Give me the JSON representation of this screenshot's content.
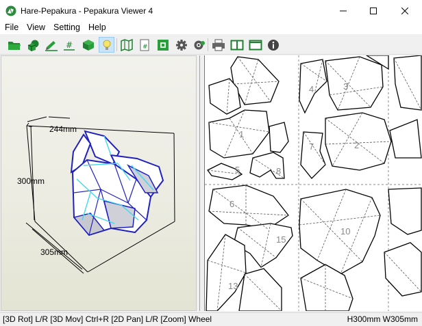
{
  "window": {
    "title": "Hare-Pepakura - Pepakura Viewer 4"
  },
  "menu": {
    "items": [
      "File",
      "View",
      "Setting",
      "Help"
    ]
  },
  "toolbar": {
    "buttons": [
      {
        "name": "open-folder-icon",
        "pressed": false
      },
      {
        "name": "3d-objects-icon",
        "pressed": false
      },
      {
        "name": "paint-icon",
        "pressed": false
      },
      {
        "name": "edge-id-icon",
        "pressed": false
      },
      {
        "name": "box-icon",
        "pressed": false
      },
      {
        "name": "light-bulb-icon",
        "pressed": true
      },
      {
        "name": "map-icon",
        "pressed": false
      },
      {
        "name": "page-number-icon",
        "pressed": false
      },
      {
        "name": "fit-icon",
        "pressed": false
      },
      {
        "name": "settings-gear-icon",
        "pressed": false
      },
      {
        "name": "view-eye-icon",
        "pressed": false
      },
      {
        "name": "print-icon",
        "pressed": false
      },
      {
        "name": "split-view-icon",
        "pressed": false
      },
      {
        "name": "single-view-icon",
        "pressed": false
      },
      {
        "name": "info-icon",
        "pressed": false
      }
    ]
  },
  "view3d": {
    "depth_label": "244mm",
    "height_label": "300mm",
    "width_label": "305mm",
    "model_colors": {
      "edge": "#2020c0",
      "fill": "#ffffff",
      "shade": "#c8c8d0",
      "fold": "#40d8f0"
    }
  },
  "view2d": {
    "part_numbers": [
      "1",
      "2",
      "3",
      "4",
      "6",
      "7",
      "8",
      "10",
      "13",
      "15",
      "5"
    ]
  },
  "status": {
    "hint": "[3D Rot] L/R [3D Mov] Ctrl+R [2D Pan] L/R [Zoom] Wheel",
    "dimensions": "H300mm W305mm"
  }
}
